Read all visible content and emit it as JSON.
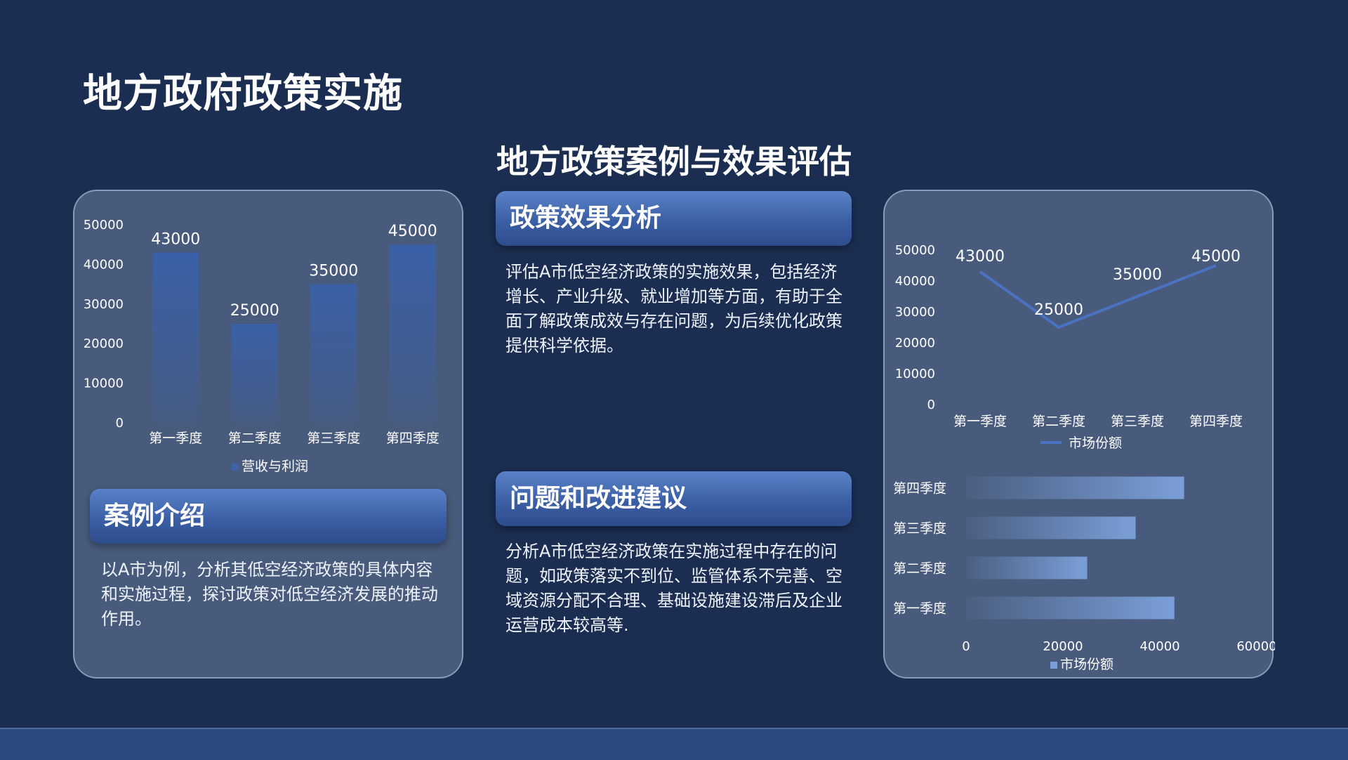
{
  "page_title": "地方政府政策实施",
  "subtitle": "地方政策案例与效果评估",
  "sections": {
    "effect": {
      "heading": "政策效果分析",
      "text": "评估A市低空经济政策的实施效果，包括经济增长、产业升级、就业增加等方面，有助于全面了解政策成效与存在问题，为后续优化政策提供科学依据。"
    },
    "issues": {
      "heading": "问题和改进建议",
      "text": "分析A市低空经济政策在实施过程中存在的问题，如政策落实不到位、监管体系不完善、空域资源分配不合理、基础设施建设滞后及企业运营成本较高等."
    },
    "case": {
      "heading": "案例介绍",
      "text": "以A市为例，分析其低空经济政策的具体内容和实施过程，探讨政策对低空经济发展的推动作用。"
    }
  },
  "colors": {
    "background": "#1b2d50",
    "bar_blue": "#3d63a8",
    "line_blue": "#4a72c0",
    "hbar_blue": "#7a9fd8"
  },
  "chart_data": [
    {
      "type": "bar",
      "categories": [
        "第一季度",
        "第二季度",
        "第三季度",
        "第四季度"
      ],
      "series": [
        {
          "name": "营收与利润",
          "values": [
            43000,
            25000,
            35000,
            45000
          ]
        }
      ],
      "ylim": [
        0,
        50000
      ],
      "yticks": [
        0,
        10000,
        20000,
        30000,
        40000,
        50000
      ],
      "data_labels": true,
      "legend": "bottom"
    },
    {
      "type": "line",
      "categories": [
        "第一季度",
        "第二季度",
        "第三季度",
        "第四季度"
      ],
      "series": [
        {
          "name": "市场份额",
          "values": [
            43000,
            25000,
            35000,
            45000
          ]
        }
      ],
      "ylim": [
        0,
        50000
      ],
      "yticks": [
        0,
        10000,
        20000,
        30000,
        40000,
        50000
      ],
      "data_labels": true,
      "legend": "bottom"
    },
    {
      "type": "bar",
      "orientation": "horizontal",
      "categories": [
        "第四季度",
        "第三季度",
        "第二季度",
        "第一季度"
      ],
      "series": [
        {
          "name": "市场份额",
          "values": [
            45000,
            35000,
            25000,
            43000
          ]
        }
      ],
      "xlim": [
        0,
        60000
      ],
      "xticks": [
        0,
        20000,
        40000,
        60000
      ],
      "legend": "bottom"
    }
  ]
}
